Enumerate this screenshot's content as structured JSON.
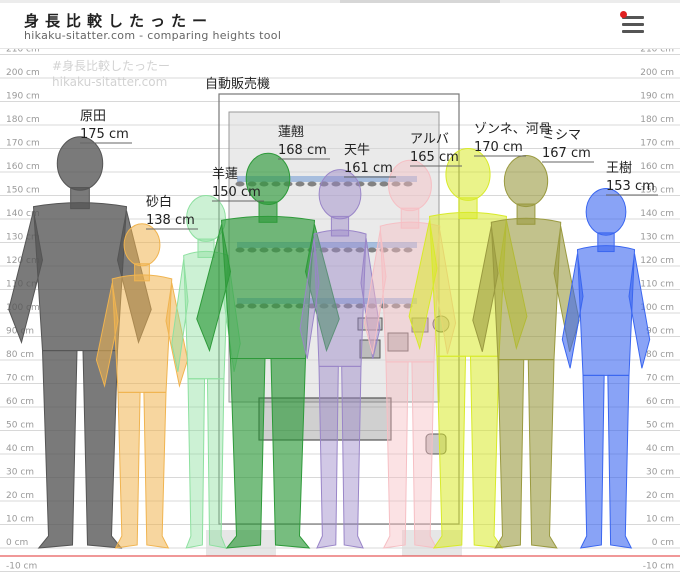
{
  "header": {
    "title": "身長比較したったー",
    "subtitle": "hikaku-sitatter.com - comparing heights tool"
  },
  "menu": {
    "icon": "hamburger-menu-icon",
    "badge_color": "#e02020"
  },
  "watermark": {
    "line1": "#身長比較したったー",
    "line2": "hikaku-sitatter.com"
  },
  "scale": {
    "unit": "cm",
    "ticks": [
      {
        "value": 210,
        "label": "210 cm"
      },
      {
        "value": 200,
        "label": "200 cm"
      },
      {
        "value": 190,
        "label": "190 cm"
      },
      {
        "value": 180,
        "label": "180 cm"
      },
      {
        "value": 170,
        "label": "170 cm"
      },
      {
        "value": 160,
        "label": "160 cm"
      },
      {
        "value": 150,
        "label": "150 cm"
      },
      {
        "value": 140,
        "label": "140 cm"
      },
      {
        "value": 130,
        "label": "130 cm"
      },
      {
        "value": 120,
        "label": "120 cm"
      },
      {
        "value": 110,
        "label": "110 cm"
      },
      {
        "value": 100,
        "label": "100 cm"
      },
      {
        "value": 90,
        "label": "90 cm"
      },
      {
        "value": 80,
        "label": "80 cm"
      },
      {
        "value": 70,
        "label": "70 cm"
      },
      {
        "value": 60,
        "label": "60 cm"
      },
      {
        "value": 50,
        "label": "50 cm"
      },
      {
        "value": 40,
        "label": "40 cm"
      },
      {
        "value": 30,
        "label": "30 cm"
      },
      {
        "value": 20,
        "label": "20 cm"
      },
      {
        "value": 10,
        "label": "10 cm"
      },
      {
        "value": 0,
        "label": "0 cm"
      },
      {
        "value": -10,
        "label": "-10 cm"
      }
    ]
  },
  "object": {
    "name": "自動販売機",
    "height_cm": 193
  },
  "people": [
    {
      "name": "原田",
      "height": 175,
      "label": "175 cm",
      "color": "#555555"
    },
    {
      "name": "砂白",
      "height": 138,
      "label": "138 cm",
      "color": "#f0b450"
    },
    {
      "name": "羊蓮",
      "height": 150,
      "label": "150 cm",
      "color": "#8ee0a0"
    },
    {
      "name": "蓮翹",
      "height": 168,
      "label": "168 cm",
      "color": "#2e9a3a"
    },
    {
      "name": "天牛",
      "height": 161,
      "label": "161 cm",
      "color": "#9a86c8"
    },
    {
      "name": "アルバ",
      "height": 165,
      "label": "165 cm",
      "color": "#f6bfc4"
    },
    {
      "name": "ゾンネ、河骨",
      "height": 170,
      "label": "170 cm",
      "color": "#d8ea2a"
    },
    {
      "name": "ミシマ",
      "height": 167,
      "label": "167 cm",
      "color": "#9a9a40"
    },
    {
      "name": "王樹",
      "height": 153,
      "label": "153 cm",
      "color": "#3a66f0"
    }
  ]
}
